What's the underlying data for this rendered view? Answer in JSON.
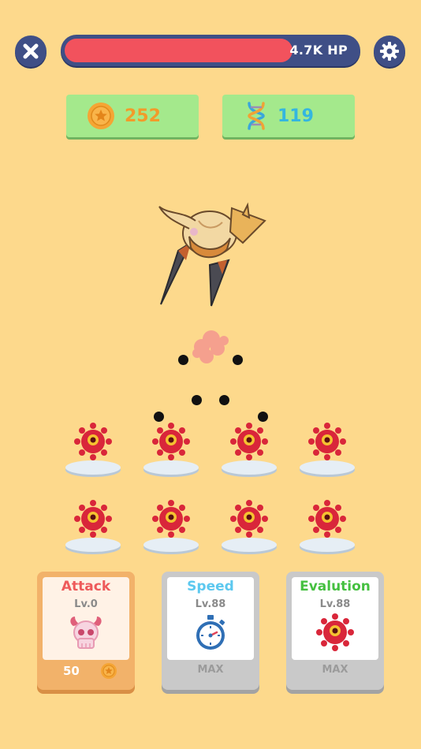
{
  "top_bar": {
    "close_icon": "close-icon",
    "settings_icon": "gear-icon",
    "hp_text": "4.7K  HP",
    "hp_fraction": 0.78,
    "colors": {
      "bar": "#3f4f86",
      "fill": "#f2525d"
    }
  },
  "resources": {
    "coins": {
      "icon": "coin-star-icon",
      "value": "252"
    },
    "dna": {
      "icon": "dna-icon",
      "value": "119"
    }
  },
  "boss": {
    "icon": "armored-beetle-boss"
  },
  "viruses": {
    "icon": "red-virus-icon",
    "count": 8
  },
  "upgrades": {
    "attack": {
      "title": "Attack",
      "level": "Lv.0",
      "icon": "skull-icon",
      "cost": "50",
      "cost_icon": "coin-icon",
      "title_color": "#ee5a5a"
    },
    "speed": {
      "title": "Speed",
      "level": "Lv.88",
      "icon": "stopwatch-icon",
      "footer": "MAX",
      "title_color": "#5cc8ef"
    },
    "evolution": {
      "title": "Evalution",
      "level": "Lv.88",
      "icon": "red-virus-icon",
      "footer": "MAX",
      "title_color": "#45c040"
    }
  }
}
